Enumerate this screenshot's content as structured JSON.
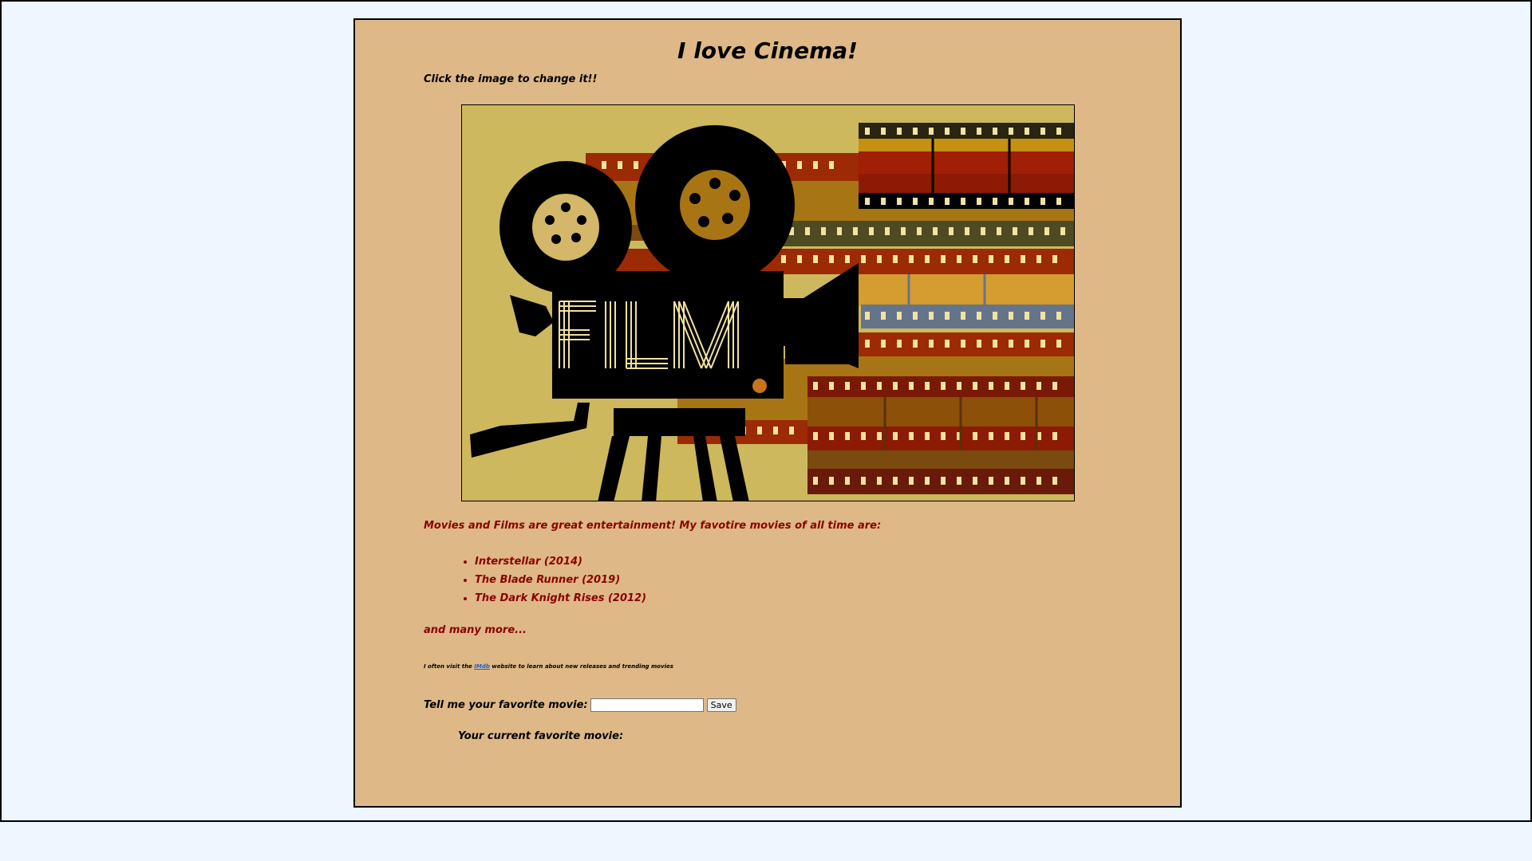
{
  "page": {
    "title": "I love Cinema!",
    "hint": "Click the image to change it!!"
  },
  "hero_image": {
    "icon": "film-camera-icon",
    "lettering": "FILM",
    "colors": {
      "background": "#cdb85e",
      "strip_red": "#9b2a05",
      "strip_gold": "#a87514",
      "strip_dark": "#2a2410",
      "strip_blue": "#64748a",
      "camera": "#000000"
    }
  },
  "intro": "Movies and Films are great entertainment! My favotire movies of all time are:",
  "movies": [
    "Interstellar (2014)",
    "The Blade Runner (2019)",
    "The Dark Knight Rises (2012)"
  ],
  "more": "and many more...",
  "imdb_note": {
    "before": "I often visit the",
    "link": "IMdb",
    "after": "website to learn about new releases and trending movies"
  },
  "favorite_form": {
    "label": "Tell me your favorite movie:",
    "input_value": "",
    "save_label": "Save"
  },
  "current_favorite_label": "Your current favorite movie:",
  "colors": {
    "page_bg": "#eef6ff",
    "card_bg": "#deb887",
    "accent_text": "#8b0000",
    "link": "#1a5fd0"
  }
}
